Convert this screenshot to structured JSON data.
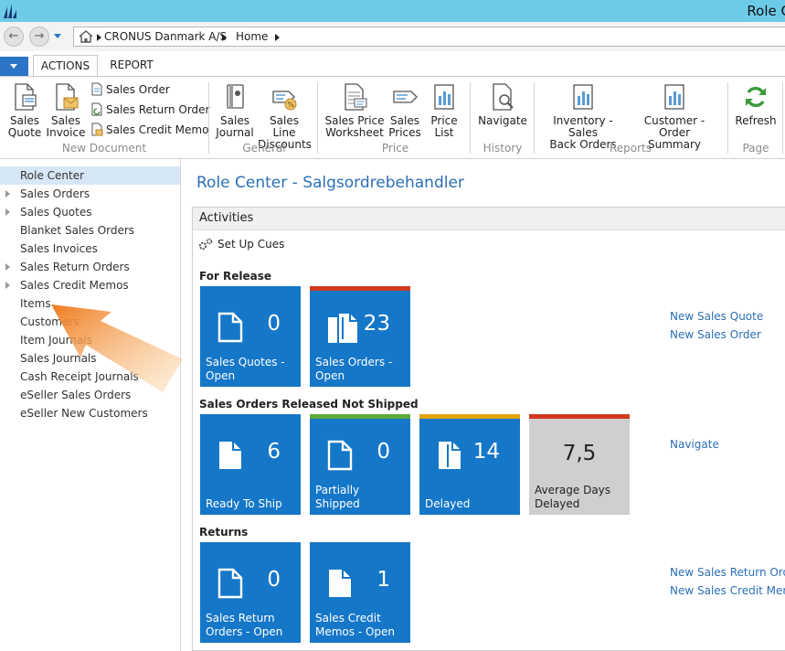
{
  "window": {
    "title": "Role C"
  },
  "nav": {
    "back_label": "←",
    "forward_label": "→",
    "breadcrumb": [
      "CRONUS Danmark A/S",
      "Home"
    ]
  },
  "tabs": [
    "ACTIONS",
    "REPORT"
  ],
  "ribbon": {
    "groups": {
      "new_document": "New Document",
      "general": "General",
      "price": "Price",
      "history": "History",
      "reports": "Reports",
      "page": "Page"
    },
    "buttons": {
      "sales_quote": [
        "Sales",
        "Quote"
      ],
      "sales_invoice": [
        "Sales",
        "Invoice"
      ],
      "sales_order": "Sales Order",
      "sales_return_order": "Sales Return Order",
      "sales_credit_memo": "Sales Credit Memo",
      "sales_journal": [
        "Sales",
        "Journal"
      ],
      "sales_line_discounts": [
        "Sales Line",
        "Discounts"
      ],
      "sales_price_worksheet": [
        "Sales Price",
        "Worksheet"
      ],
      "sales_prices": [
        "Sales",
        "Prices"
      ],
      "price_list": [
        "Price",
        "List"
      ],
      "navigate": "Navigate",
      "inventory_sales_back_orders": [
        "Inventory - Sales",
        "Back Orders"
      ],
      "customer_order_summary": [
        "Customer - Order",
        "Summary"
      ],
      "refresh": "Refresh"
    }
  },
  "sidebar": {
    "items": [
      {
        "label": "Role Center",
        "selected": true,
        "expandable": false
      },
      {
        "label": "Sales Orders",
        "expandable": true
      },
      {
        "label": "Sales Quotes",
        "expandable": true
      },
      {
        "label": "Blanket Sales Orders",
        "expandable": false
      },
      {
        "label": "Sales Invoices",
        "expandable": false
      },
      {
        "label": "Sales Return Orders",
        "expandable": true
      },
      {
        "label": "Sales Credit Memos",
        "expandable": true
      },
      {
        "label": "Items",
        "expandable": false
      },
      {
        "label": "Customers",
        "expandable": false
      },
      {
        "label": "Item Journals",
        "expandable": false
      },
      {
        "label": "Sales Journals",
        "expandable": false
      },
      {
        "label": "Cash Receipt Journals",
        "expandable": false
      },
      {
        "label": "eSeller Sales Orders",
        "expandable": false
      },
      {
        "label": "eSeller New Customers",
        "expandable": false
      }
    ]
  },
  "main": {
    "title": "Role Center - Salgsordrebehandler",
    "activities_label": "Activities",
    "setup_cues_label": "Set Up Cues",
    "sections": [
      {
        "title": "For Release",
        "tiles": [
          {
            "value": "0",
            "label": [
              "Sales Quotes -",
              "Open"
            ],
            "bar": null
          },
          {
            "value": "23",
            "label": [
              "Sales Orders -",
              "Open"
            ],
            "bar": "#d13a1f"
          }
        ],
        "links": [
          "New Sales Quote",
          "New Sales Order"
        ]
      },
      {
        "title": "Sales Orders Released Not Shipped",
        "tiles": [
          {
            "value": "6",
            "label": [
              "Ready To Ship"
            ],
            "bar": null
          },
          {
            "value": "0",
            "label": [
              "Partially Shipped"
            ],
            "bar": "#5cab3c"
          },
          {
            "value": "14",
            "label": [
              "Delayed"
            ],
            "bar": "#e0a416"
          },
          {
            "value": "7,5",
            "label": [
              "Average Days",
              "Delayed"
            ],
            "bar": "#d13a1f"
          }
        ],
        "links": [
          "Navigate"
        ]
      },
      {
        "title": "Returns",
        "tiles": [
          {
            "value": "0",
            "label": [
              "Sales Return",
              "Orders - Open"
            ],
            "bar": null
          },
          {
            "value": "1",
            "label": [
              "Sales Credit",
              "Memos - Open"
            ],
            "bar": null
          }
        ],
        "links": [
          "New Sales Return Order",
          "New Sales Credit Memo"
        ]
      }
    ]
  },
  "colors": {
    "tile": "#1577c8",
    "link": "#2b6fb5",
    "titlebar": "#6ecbe8",
    "highlight_arrow": "#f28a2c"
  }
}
